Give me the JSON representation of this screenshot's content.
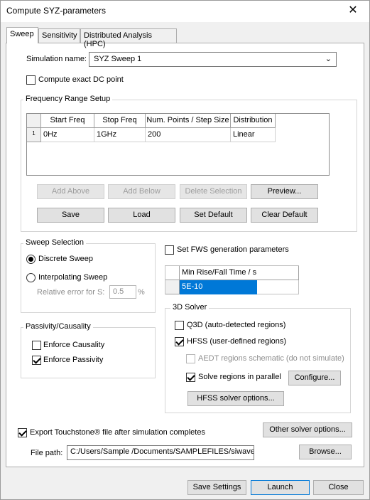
{
  "window": {
    "title": "Compute SYZ-parameters",
    "close_glyph": "✕"
  },
  "tabs": [
    {
      "label": "Sweep"
    },
    {
      "label": "Sensitivity"
    },
    {
      "label": "Distributed Analysis (HPC)"
    }
  ],
  "simulation": {
    "name_label": "Simulation name:",
    "name_value": "SYZ Sweep 1",
    "exact_dc_label": "Compute exact DC point",
    "exact_dc_checked": false
  },
  "freq_range": {
    "title": "Frequency Range Setup",
    "columns": [
      "Start Freq",
      "Stop Freq",
      "Num. Points / Step Size",
      "Distribution"
    ],
    "rows": [
      {
        "index": "1",
        "cells": [
          "0Hz",
          "1GHz",
          "200",
          "Linear"
        ]
      }
    ],
    "buttons": {
      "add_above": "Add Above",
      "add_below": "Add Below",
      "delete_selection": "Delete Selection",
      "preview": "Preview...",
      "save": "Save",
      "load": "Load",
      "set_default": "Set Default",
      "clear_default": "Clear Default"
    }
  },
  "sweep_selection": {
    "title": "Sweep Selection",
    "discrete_label": "Discrete Sweep",
    "interpolating_label": "Interpolating Sweep",
    "selected": "discrete",
    "rel_error_label": "Relative error for S:",
    "rel_error_value": "0.5",
    "rel_error_unit": "%"
  },
  "fws": {
    "label": "Set FWS generation parameters",
    "checked": false,
    "column": "Min Rise/Fall Time / s",
    "value": "5E-10"
  },
  "passivity": {
    "title": "Passivity/Causality",
    "causality_label": "Enforce Causality",
    "causality_checked": false,
    "passivity_label": "Enforce Passivity",
    "passivity_checked": true
  },
  "solver3d": {
    "title": "3D Solver",
    "q3d_label": "Q3D (auto-detected regions)",
    "q3d_checked": false,
    "hfss_label": "HFSS (user-defined regions)",
    "hfss_checked": true,
    "aedt_label": "AEDT regions schematic (do not simulate)",
    "aedt_checked": false,
    "parallel_label": "Solve regions in parallel",
    "parallel_checked": true,
    "configure_label": "Configure...",
    "hfss_options_label": "HFSS solver options..."
  },
  "export": {
    "label": "Export Touchstone® file after simulation completes",
    "checked": true,
    "other_options_label": "Other solver options...",
    "file_path_label": "File path:",
    "file_path_value": "C:/Users/Sample /Documents/SAMPLEFILES/siwave_t",
    "browse_label": "Browse..."
  },
  "footer": {
    "save_settings": "Save Settings",
    "launch": "Launch",
    "close": "Close"
  },
  "colors": {
    "selection": "#0078d7",
    "focus_border": "#0078d7"
  }
}
